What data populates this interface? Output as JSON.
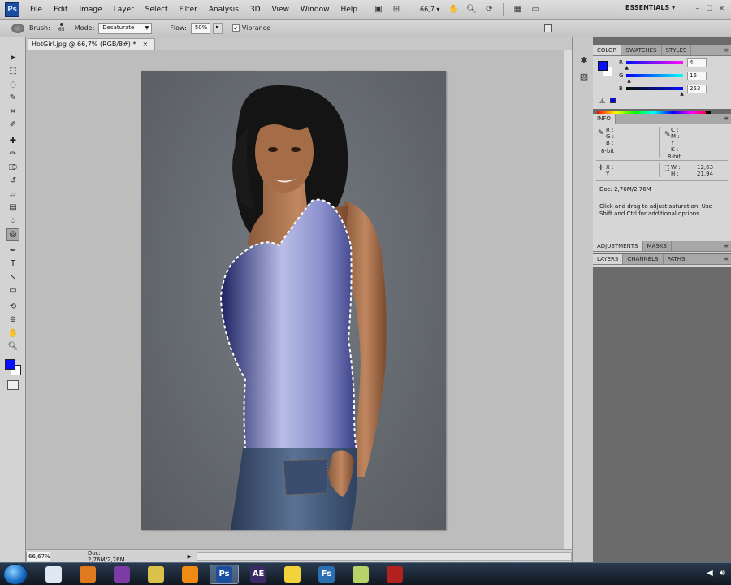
{
  "app": {
    "logo": "Ps"
  },
  "menu": [
    "File",
    "Edit",
    "Image",
    "Layer",
    "Select",
    "Filter",
    "Analysis",
    "3D",
    "View",
    "Window",
    "Help"
  ],
  "menubar_tools": {
    "zoom": "66,7",
    "workspace": "ESSENTIALS"
  },
  "options": {
    "brush_label": "Brush:",
    "brush_size": "65",
    "mode_label": "Mode:",
    "mode_value": "Desaturate",
    "flow_label": "Flow:",
    "flow_value": "50%",
    "vibrance_label": "Vibrance",
    "vibrance_checked": true
  },
  "document": {
    "tab_title": "HotGirl.jpg @ 66,7% (RGB/8#) *",
    "tab_close": "×"
  },
  "status": {
    "zoom": "66,67%",
    "doc": "Doc: 2,76M/2,76M"
  },
  "colors": {
    "foreground": "#0410fd",
    "background": "#ffffff",
    "accent": "#1c4ea0"
  },
  "color_panel": {
    "tabs": [
      "COLOR",
      "SWATCHES",
      "STYLES"
    ],
    "sliders": [
      {
        "label": "R",
        "value": "4",
        "fraction": 0.02
      },
      {
        "label": "G",
        "value": "16",
        "fraction": 0.06
      },
      {
        "label": "B",
        "value": "253",
        "fraction": 0.99
      }
    ]
  },
  "info_panel": {
    "tabs": [
      "INFO"
    ],
    "rgb_labels": "R :\nG :\nB :",
    "bit_left": "8-bit",
    "cmyk_labels": "C :\nM :\nY :\nK :",
    "bit_right": "8-bit",
    "xy_labels": "X :\nY :",
    "wh_labels": "W :\nH :",
    "w_value": "12,63",
    "h_value": "21,94",
    "doc": "Doc: 2,76M/2,76M",
    "note": "Click and drag to adjust saturation.  Use Shift and Ctrl for additional options."
  },
  "adjust_panel": {
    "tabs": [
      "ADJUSTMENTS",
      "MASKS"
    ]
  },
  "layers_panel": {
    "tabs": [
      "LAYERS",
      "CHANNELS",
      "PATHS"
    ]
  },
  "tools": [
    "move-tool",
    "marquee-tool",
    "lasso-tool",
    "quick-selection-tool",
    "crop-tool",
    "eyedropper-tool",
    "spot-healing-tool",
    "brush-tool",
    "clone-stamp-tool",
    "history-brush-tool",
    "eraser-tool",
    "gradient-tool",
    "blur-tool",
    "sponge-tool",
    "pen-tool",
    "type-tool",
    "path-selection-tool",
    "shape-tool",
    "3d-rotate-tool",
    "3d-orbit-tool",
    "hand-tool",
    "zoom-tool"
  ],
  "taskbar": {
    "items": [
      {
        "name": "explorer",
        "label": ""
      },
      {
        "name": "firefox",
        "label": ""
      },
      {
        "name": "yahoo-messenger",
        "label": ""
      },
      {
        "name": "notes",
        "label": ""
      },
      {
        "name": "vlc",
        "label": ""
      },
      {
        "name": "photoshop",
        "label": "Ps"
      },
      {
        "name": "after-effects",
        "label": "AE"
      },
      {
        "name": "smiley",
        "label": ""
      },
      {
        "name": "flash",
        "label": "Fs"
      },
      {
        "name": "app-green",
        "label": ""
      },
      {
        "name": "app-red",
        "label": ""
      }
    ]
  }
}
